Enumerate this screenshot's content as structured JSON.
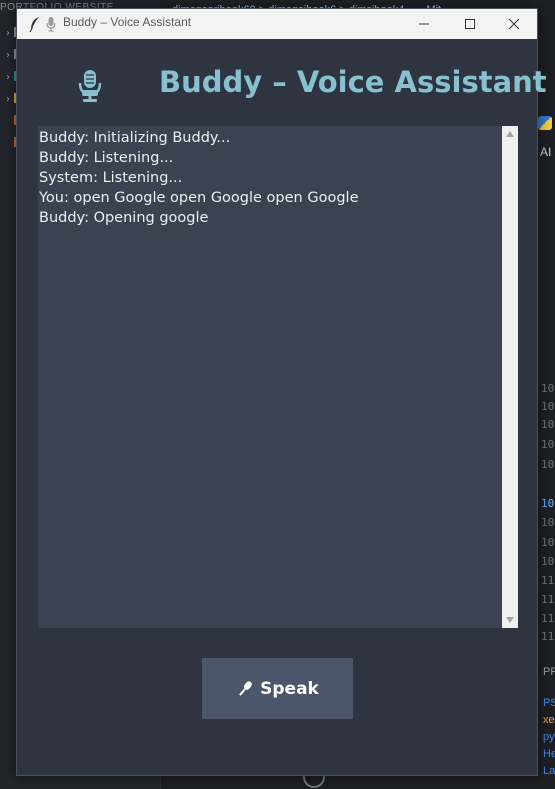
{
  "window": {
    "title": "Buddy – Voice Assistant",
    "icon": "feather-icon"
  },
  "header": {
    "title": "Buddy – Voice Assistant",
    "icon": "microphone-icon"
  },
  "chat": {
    "lines": [
      "Buddy: Initializing Buddy...",
      "Buddy: Listening...",
      "System: Listening...",
      "You: open Google open Google open Google",
      "Buddy: Opening google"
    ]
  },
  "speak_button": {
    "label": "Speak",
    "icon": "microphone-icon"
  },
  "background_ide": {
    "explorer_title": "PORTFOLIO WEBSITE",
    "tabs_text": "dimensoribook60 > dimensibook6 > dimsibook4 ... - Mit",
    "ai_label": "AI",
    "line_numbers": [
      "10",
      "10",
      "10",
      "10",
      "10",
      "10",
      "10",
      "10",
      "10",
      "10",
      "10",
      "11",
      "11",
      "11",
      "11"
    ],
    "active_line_number": "10",
    "panel_label": "PR",
    "terminal_lines": [
      "PS",
      "xe",
      "py",
      "He",
      "La"
    ]
  },
  "colors": {
    "window_bg": "#2e3440",
    "chat_bg": "#3b4252",
    "title_accent": "#88c0d0",
    "button_bg": "#4c566a",
    "text": "#eceff4"
  }
}
